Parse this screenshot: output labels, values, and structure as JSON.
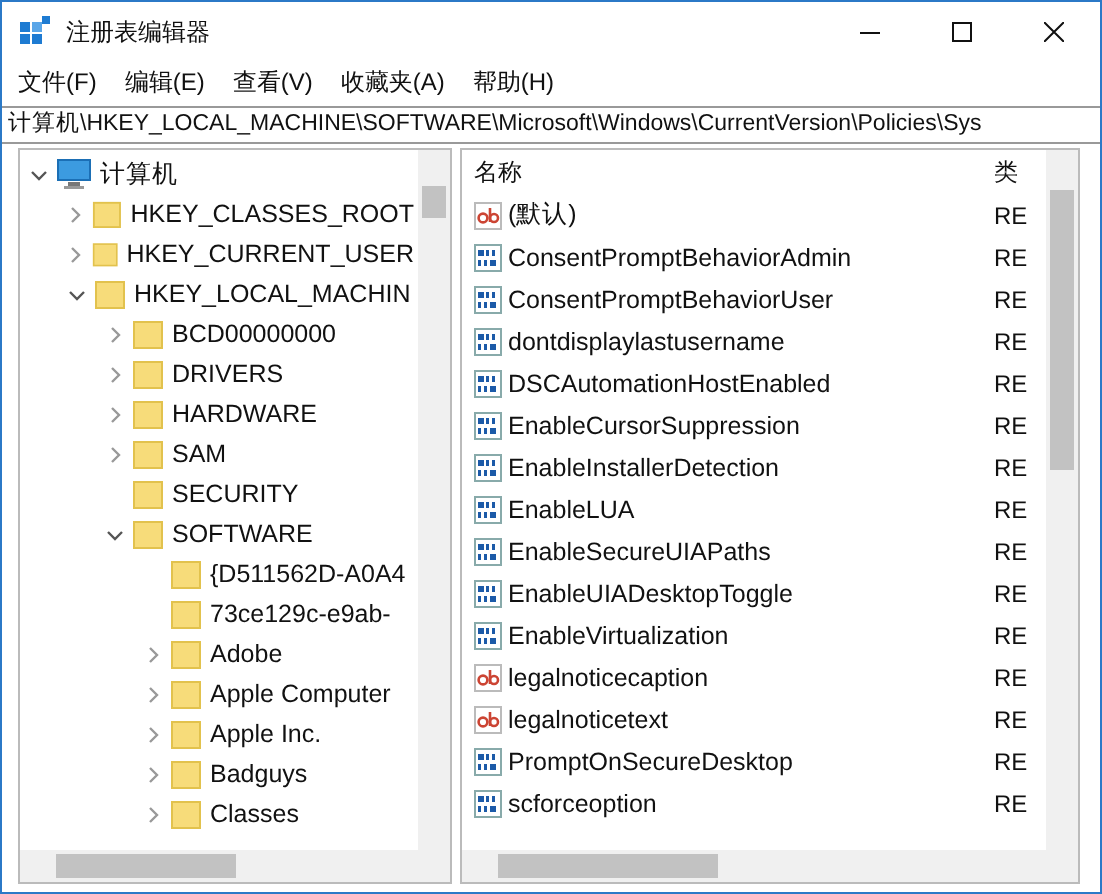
{
  "window": {
    "title": "注册表编辑器"
  },
  "menu": [
    "文件(F)",
    "编辑(E)",
    "查看(V)",
    "收藏夹(A)",
    "帮助(H)"
  ],
  "address": "计算机\\HKEY_LOCAL_MACHINE\\SOFTWARE\\Microsoft\\Windows\\CurrentVersion\\Policies\\Sys",
  "tree": {
    "label": "计算机",
    "expanded": true,
    "children": [
      {
        "label": "HKEY_CLASSES_ROOT",
        "expanded": false
      },
      {
        "label": "HKEY_CURRENT_USER",
        "expanded": false
      },
      {
        "label": "HKEY_LOCAL_MACHIN",
        "expanded": true,
        "children": [
          {
            "label": "BCD00000000",
            "expanded": false
          },
          {
            "label": "DRIVERS",
            "expanded": false
          },
          {
            "label": "HARDWARE",
            "expanded": false
          },
          {
            "label": "SAM",
            "expanded": false
          },
          {
            "label": "SECURITY"
          },
          {
            "label": "SOFTWARE",
            "expanded": true,
            "children": [
              {
                "label": "{D511562D-A0A4"
              },
              {
                "label": "73ce129c-e9ab-"
              },
              {
                "label": "Adobe",
                "expanded": false
              },
              {
                "label": "Apple Computer",
                "expanded": false
              },
              {
                "label": "Apple Inc.",
                "expanded": false
              },
              {
                "label": "Badguys",
                "expanded": false
              },
              {
                "label": "Classes",
                "expanded": false
              }
            ]
          }
        ]
      }
    ]
  },
  "values": {
    "columns": [
      "名称",
      "类"
    ],
    "rows": [
      {
        "kind": "string",
        "name": "(默认)",
        "type": "RE"
      },
      {
        "kind": "dword",
        "name": "ConsentPromptBehaviorAdmin",
        "type": "RE"
      },
      {
        "kind": "dword",
        "name": "ConsentPromptBehaviorUser",
        "type": "RE"
      },
      {
        "kind": "dword",
        "name": "dontdisplaylastusername",
        "type": "RE"
      },
      {
        "kind": "dword",
        "name": "DSCAutomationHostEnabled",
        "type": "RE"
      },
      {
        "kind": "dword",
        "name": "EnableCursorSuppression",
        "type": "RE"
      },
      {
        "kind": "dword",
        "name": "EnableInstallerDetection",
        "type": "RE"
      },
      {
        "kind": "dword",
        "name": "EnableLUA",
        "type": "RE"
      },
      {
        "kind": "dword",
        "name": "EnableSecureUIAPaths",
        "type": "RE"
      },
      {
        "kind": "dword",
        "name": "EnableUIADesktopToggle",
        "type": "RE"
      },
      {
        "kind": "dword",
        "name": "EnableVirtualization",
        "type": "RE"
      },
      {
        "kind": "string",
        "name": "legalnoticecaption",
        "type": "RE"
      },
      {
        "kind": "string",
        "name": "legalnoticetext",
        "type": "RE"
      },
      {
        "kind": "dword",
        "name": "PromptOnSecureDesktop",
        "type": "RE"
      },
      {
        "kind": "dword",
        "name": "scforceoption",
        "type": "RE"
      }
    ]
  }
}
